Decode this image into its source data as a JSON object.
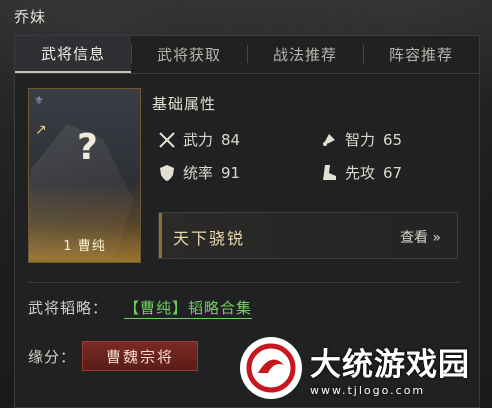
{
  "hero": {
    "name": "乔妹"
  },
  "tabs": [
    {
      "label": "武将信息",
      "active": true
    },
    {
      "label": "武将获取",
      "active": false
    },
    {
      "label": "战法推荐",
      "active": false
    },
    {
      "label": "阵容推荐",
      "active": false
    }
  ],
  "card": {
    "footer": "1 曹纯",
    "glyph": "?"
  },
  "basic": {
    "title": "基础属性",
    "attrs": [
      {
        "name": "武力",
        "value": "84",
        "icon": "crossed-swords-icon"
      },
      {
        "name": "智力",
        "value": "65",
        "icon": "brain-icon"
      },
      {
        "name": "统率",
        "value": "91",
        "icon": "shield-icon"
      },
      {
        "name": "先攻",
        "value": "67",
        "icon": "boot-icon"
      }
    ]
  },
  "skill": {
    "name": "天下骁锐",
    "view": "查看 »"
  },
  "strategy": {
    "label": "武将韬略：",
    "link": "【曹纯】韬略合集"
  },
  "fate": {
    "label": "缘分：",
    "tag": "曹魏宗将"
  },
  "watermark": {
    "name": "大统游戏园",
    "url": "www.tjlogo.com"
  }
}
